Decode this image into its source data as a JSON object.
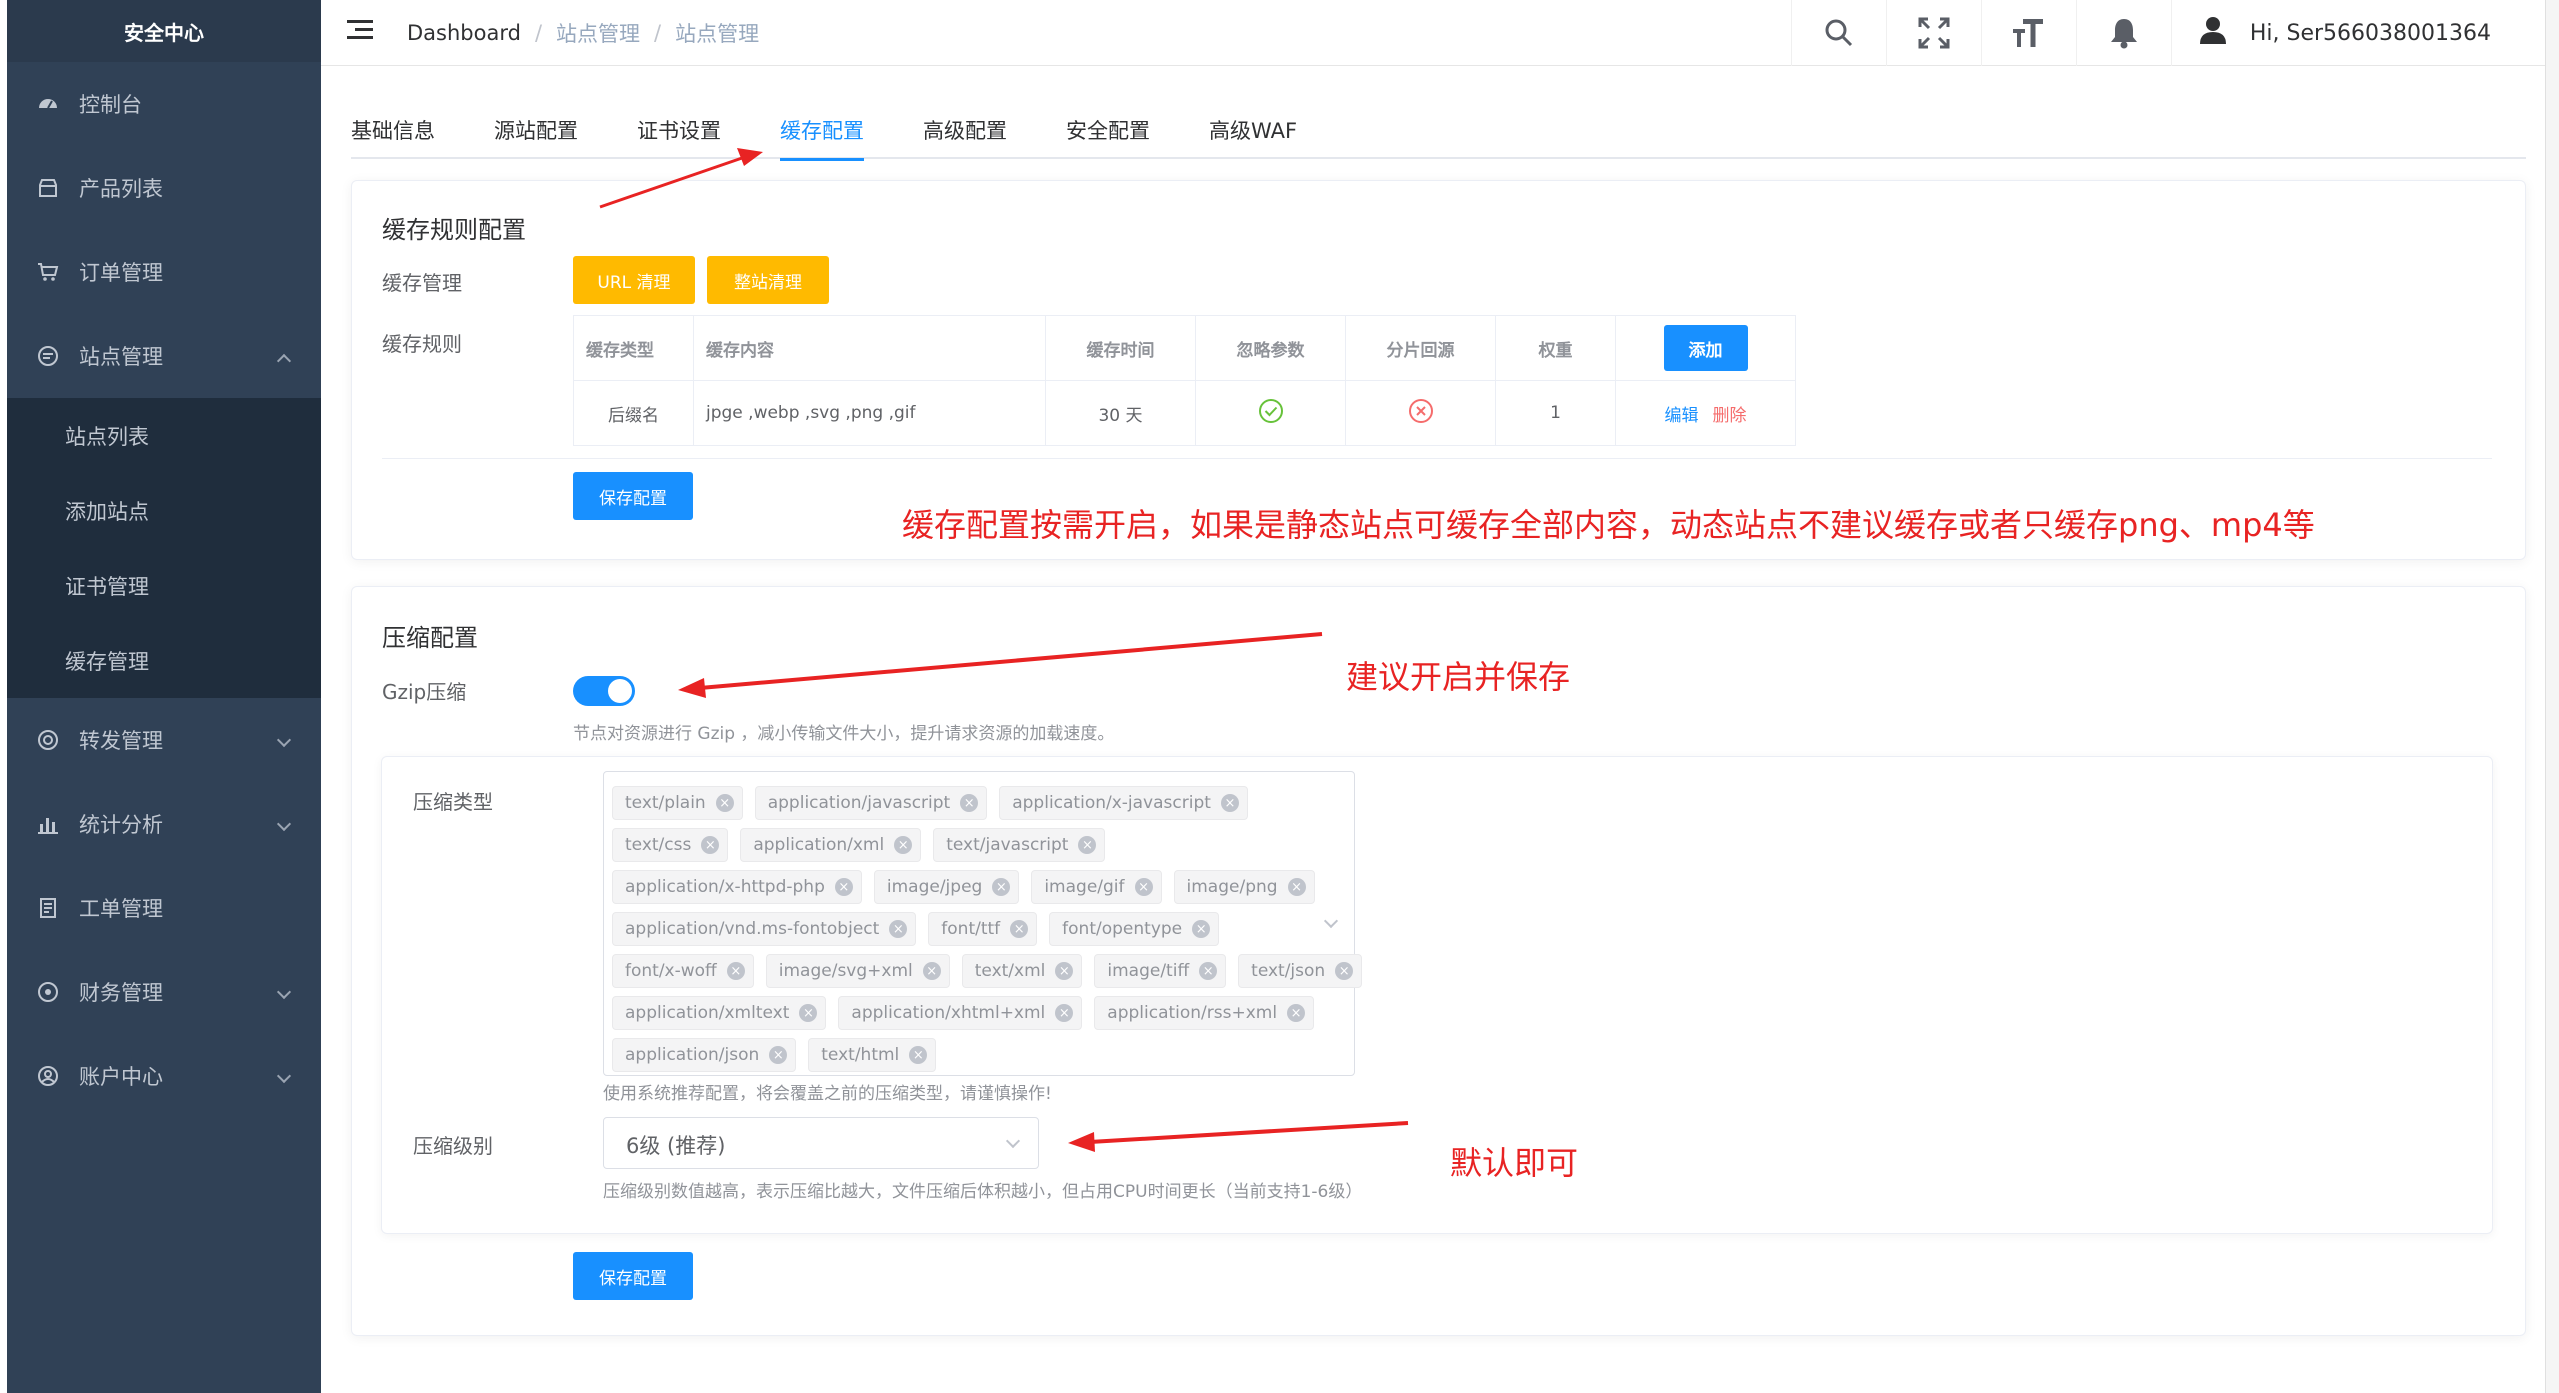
{
  "sidebar": {
    "title": "安全中心",
    "items": [
      {
        "label": "控制台",
        "icon": "dashboard-icon"
      },
      {
        "label": "产品列表",
        "icon": "store-icon"
      },
      {
        "label": "订单管理",
        "icon": "cart-icon"
      },
      {
        "label": "站点管理",
        "icon": "site-icon"
      },
      {
        "label": "转发管理",
        "icon": "forward-icon"
      },
      {
        "label": "统计分析",
        "icon": "chart-icon"
      },
      {
        "label": "工单管理",
        "icon": "ticket-icon"
      },
      {
        "label": "财务管理",
        "icon": "finance-icon"
      },
      {
        "label": "账户中心",
        "icon": "user-icon"
      }
    ],
    "subitems": [
      "站点列表",
      "添加站点",
      "证书管理",
      "缓存管理"
    ]
  },
  "header": {
    "breadcrumb": [
      "Dashboard",
      "站点管理",
      "站点管理"
    ],
    "greeting": "Hi, Ser566038001364"
  },
  "tabs": [
    "基础信息",
    "源站配置",
    "证书设置",
    "缓存配置",
    "高级配置",
    "安全配置",
    "高级WAF"
  ],
  "cache": {
    "title": "缓存规则配置",
    "manage_label": "缓存管理",
    "url_clear": "URL 清理",
    "site_clear": "整站清理",
    "rules_label": "缓存规则",
    "columns": [
      "缓存类型",
      "缓存内容",
      "缓存时间",
      "忽略参数",
      "分片回源",
      "权重"
    ],
    "add_button": "添加",
    "row": {
      "type": "后缀名",
      "content": "jpge ,webp ,svg ,png ,gif",
      "time": "30 天",
      "ignore_params": true,
      "range_origin": false,
      "weight": "1",
      "edit": "编辑",
      "delete": "删除"
    },
    "save": "保存配置"
  },
  "compress": {
    "title": "压缩配置",
    "gzip_label": "Gzip压缩",
    "gzip_enabled": true,
    "gzip_hint": "节点对资源进行 Gzip ，减小传输文件大小，提升请求资源的加载速度。",
    "type_label": "压缩类型",
    "tag_rows": [
      [
        "text/plain",
        "application/javascript",
        "application/x-javascript"
      ],
      [
        "text/css",
        "application/xml",
        "text/javascript"
      ],
      [
        "application/x-httpd-php",
        "image/jpeg",
        "image/gif",
        "image/png"
      ],
      [
        "application/vnd.ms-fontobject",
        "font/ttf",
        "font/opentype"
      ],
      [
        "font/x-woff",
        "image/svg+xml",
        "text/xml",
        "image/tiff",
        "text/json"
      ],
      [
        "application/xmltext",
        "application/xhtml+xml",
        "application/rss+xml"
      ],
      [
        "application/json",
        "text/html"
      ]
    ],
    "type_hint": "使用系统推荐配置，将会覆盖之前的压缩类型，请谨慎操作!",
    "level_label": "压缩级别",
    "level_value": "6级 (推荐)",
    "level_hint": "压缩级别数值越高，表示压缩比越大，文件压缩后体积越小，但占用CPU时间更长（当前支持1-6级）",
    "save": "保存配置"
  },
  "annotations": {
    "cache_note": "缓存配置按需开启，如果是静态站点可缓存全部内容，动态站点不建议缓存或者只缓存png、mp4等",
    "gzip_note": "建议开启并保存",
    "level_note": "默认即可"
  },
  "colors": {
    "sidebar_bg": "#304156",
    "primary": "#1890ff",
    "warning": "#ffba00",
    "danger": "#f56c6c",
    "success": "#67c23a",
    "annotation": "#e82323"
  }
}
